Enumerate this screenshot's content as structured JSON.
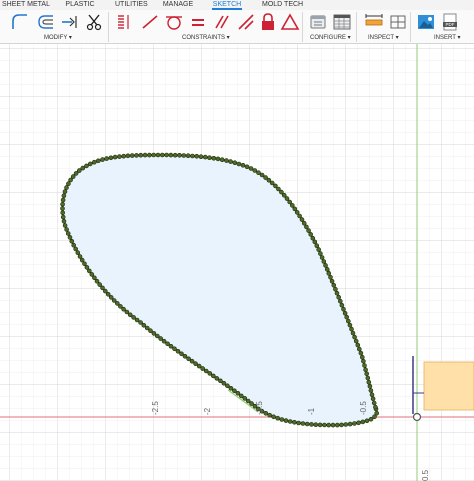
{
  "tabs": [
    "SHEET METAL",
    "PLASTIC",
    "UTILITIES",
    "MANAGE",
    "SKETCH",
    "MOLD TECH"
  ],
  "active_tab": "SKETCH",
  "groups": {
    "modify": "MODIFY ▾",
    "constraints": "CONSTRAINTS ▾",
    "configure": "CONFIGURE ▾",
    "inspect": "INSPECT ▾",
    "insert": "INSERT ▾"
  },
  "icons": {
    "modify": [
      "fillet-icon",
      "offset-icon",
      "extend-icon",
      "trim-icon"
    ],
    "constraints": [
      "coincident-icon",
      "tangent-icon",
      "parallel-icon",
      "equal-icon",
      "fix-icon",
      "symmetry-icon"
    ],
    "configure": [
      "configure-icon",
      "table-icon"
    ],
    "inspect": [
      "measure-icon"
    ],
    "insert": [
      "insert-image-icon",
      "insert-pdf-icon"
    ]
  },
  "axis_labels": [
    "-2.5",
    "-2",
    "-1.5",
    "-1",
    "-0.5"
  ],
  "vertical_axis_label": "0.5",
  "colors": {
    "accent": "#1f7ed6",
    "profile_fill": "#e9f3fd",
    "spline_point": "#4f6b2a",
    "origin_axis_red": "#e0707a",
    "origin_axis_green": "#8fcf75",
    "selection_box": "#ffe0a8"
  }
}
